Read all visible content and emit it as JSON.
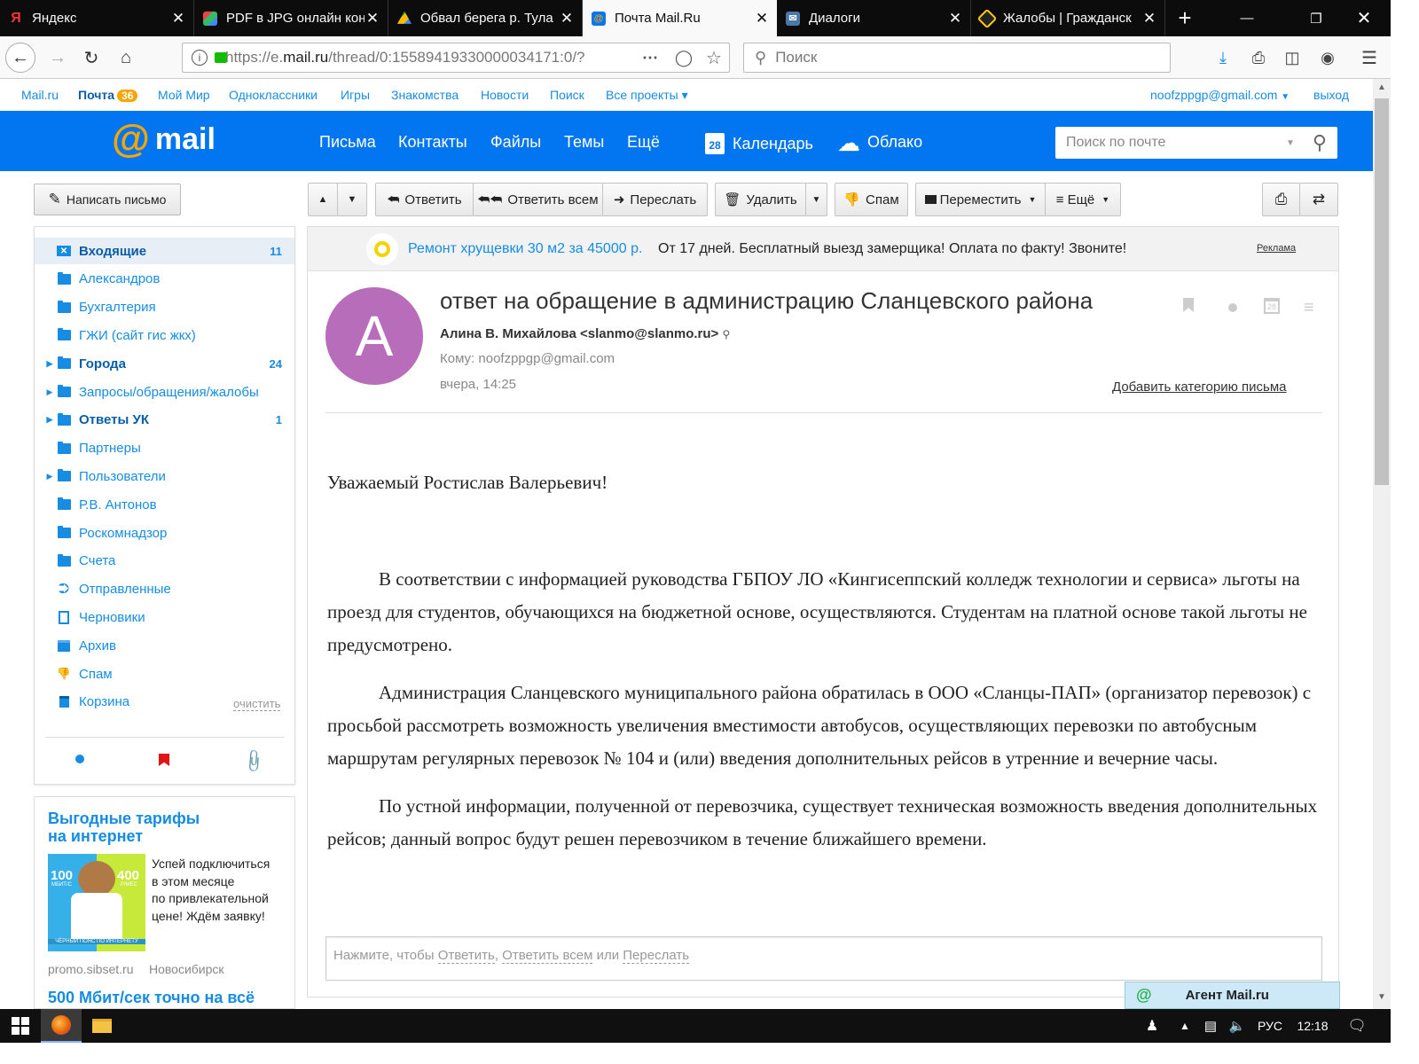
{
  "browser": {
    "tabs": [
      {
        "title": "Яндекс",
        "icon": "yandex-icon",
        "active": false
      },
      {
        "title": "PDF в JPG онлайн конвертер",
        "icon": "pdf-icon",
        "active": false
      },
      {
        "title": "Обвал берега р. Тула",
        "icon": "google-drive-icon",
        "active": false
      },
      {
        "title": "Почта Mail.Ru",
        "icon": "mailru-icon",
        "active": true
      },
      {
        "title": "Диалоги",
        "icon": "chat-icon",
        "active": false
      },
      {
        "title": "Жалобы | Гражданск",
        "icon": "complaints-icon",
        "active": false
      }
    ],
    "url_prefix": "https://e.",
    "url_host": "mail.ru",
    "url_path": "/thread/0:15589419330000034171:0/?",
    "search_placeholder": "Поиск"
  },
  "portal": {
    "links": [
      {
        "label": "Mail.ru"
      },
      {
        "label": "Почта",
        "badge": "36"
      },
      {
        "label": "Мой Мир"
      },
      {
        "label": "Одноклассники"
      },
      {
        "label": "Игры"
      },
      {
        "label": "Знакомства"
      },
      {
        "label": "Новости"
      },
      {
        "label": "Поиск"
      },
      {
        "label": "Все проекты"
      }
    ],
    "user_email": "noofzppgp@gmail.com",
    "logout": "выход"
  },
  "header": {
    "logo_text": "mail",
    "nav": [
      "Письма",
      "Контакты",
      "Файлы",
      "Темы",
      "Ещё"
    ],
    "calendar": "Календарь",
    "calendar_day": "28",
    "cloud": "Облако",
    "search_placeholder": "Поиск по почте"
  },
  "sidebar": {
    "compose": "Написать письмо",
    "folders": [
      {
        "label": "Входящие",
        "count": "11",
        "icon": "inbox-icon",
        "bold": true,
        "active": true,
        "expand": false
      },
      {
        "label": "Александров",
        "count": "",
        "icon": "folder-icon",
        "bold": false,
        "active": false,
        "expand": false
      },
      {
        "label": "Бухгалтерия",
        "count": "",
        "icon": "folder-icon",
        "bold": false,
        "active": false,
        "expand": false
      },
      {
        "label": "ГЖИ (сайт гис жкх)",
        "count": "",
        "icon": "folder-icon",
        "bold": false,
        "active": false,
        "expand": false
      },
      {
        "label": "Города",
        "count": "24",
        "icon": "folder-icon",
        "bold": true,
        "active": false,
        "expand": true
      },
      {
        "label": "Запросы/обращения/жалобы",
        "count": "",
        "icon": "folder-icon",
        "bold": false,
        "active": false,
        "expand": true
      },
      {
        "label": "Ответы УК",
        "count": "1",
        "icon": "folder-icon",
        "bold": true,
        "active": false,
        "expand": true
      },
      {
        "label": "Партнеры",
        "count": "",
        "icon": "folder-icon",
        "bold": false,
        "active": false,
        "expand": false
      },
      {
        "label": "Пользователи",
        "count": "",
        "icon": "folder-icon",
        "bold": false,
        "active": false,
        "expand": true
      },
      {
        "label": "Р.В. Антонов",
        "count": "",
        "icon": "folder-icon",
        "bold": false,
        "active": false,
        "expand": false
      },
      {
        "label": "Роскомнадзор",
        "count": "",
        "icon": "folder-icon",
        "bold": false,
        "active": false,
        "expand": false
      },
      {
        "label": "Счета",
        "count": "",
        "icon": "folder-icon",
        "bold": false,
        "active": false,
        "expand": false
      },
      {
        "label": "Отправленные",
        "count": "",
        "icon": "sent-icon",
        "bold": false,
        "active": false,
        "expand": false
      },
      {
        "label": "Черновики",
        "count": "",
        "icon": "drafts-icon",
        "bold": false,
        "active": false,
        "expand": false
      },
      {
        "label": "Архив",
        "count": "",
        "icon": "archive-icon",
        "bold": false,
        "active": false,
        "expand": false
      },
      {
        "label": "Спам",
        "count": "",
        "icon": "spam-icon",
        "bold": false,
        "active": false,
        "expand": false
      },
      {
        "label": "Корзина",
        "count": "",
        "icon": "trash-icon",
        "bold": false,
        "active": false,
        "expand": false
      }
    ],
    "clear": "очистить",
    "ad": {
      "title1": "Выгодные тарифы",
      "title2": "на интернет",
      "img_left": "100",
      "img_left_unit": "МБИТ/С",
      "img_right": "400",
      "img_right_unit": "Р/МЕС",
      "img_caption": "ЧЁРНЫЙ ПОЯС ПО ИНТЕРНЕТУ",
      "text": [
        "Успей подключиться",
        "в этом месяце",
        "по привлекательной",
        "цене! Ждём заявку!"
      ],
      "domain": "promo.sibset.ru",
      "city": "Новосибирск",
      "title3": "500 Мбит/сек точно на всё"
    }
  },
  "toolbar": {
    "reply": "Ответить",
    "reply_all": "Ответить всем",
    "forward": "Переслать",
    "delete": "Удалить",
    "spam": "Спам",
    "move": "Переместить",
    "more": "Ещё"
  },
  "message": {
    "ad_link": "Ремонт хрущевки 30 м2 за 45000 р.",
    "ad_text": "От 17 дней. Бесплатный выезд замерщика! Оплата по факту! Звоните!",
    "ad_label": "Реклама",
    "avatar_letter": "А",
    "subject": "ответ на обращение в администрацию Сланцевского района",
    "sender": "Алина В. Михайлова <slanmo@slanmo.ru>",
    "to": "Кому: noofzppgp@gmail.com",
    "date": "вчера, 14:25",
    "calendar_day": "28",
    "add_category": "Добавить категорию письма",
    "greeting": "Уважаемый Ростислав Валерьевич!",
    "paragraphs": [
      "В соответствии с информацией руководства ГБПОУ ЛО «Кингисеппский колледж технологии и сервиса» льготы на проезд для студентов, обучающихся на бюджетной основе, осуществляются. Студентам на платной основе такой льготы не предусмотрено.",
      "Администрация Сланцевского муниципального района обратилась в ООО «Сланцы-ПАП» (организатор перевозок) с просьбой рассмотреть возможность увеличения вместимости автобусов, осуществляющих перевозки по автобусным маршрутам регулярных перевозок № 104 и (или) введения дополнительных рейсов в утренние и вечерние часы.",
      "По устной информации, полученной от перевозчика, существует техническая возможность введения дополнительных рейсов; данный вопрос будут решен перевозчиком в течение ближайшего времени."
    ],
    "reply_hint": "Нажмите, чтобы",
    "reply_link1": "Ответить",
    "reply_link2": "Ответить всем",
    "reply_or": "или",
    "reply_link3": "Переслать"
  },
  "agent": {
    "label": "Агент Mail.ru"
  },
  "taskbar": {
    "lang": "РУС",
    "time": "12:18"
  },
  "colors": {
    "header_blue": "#0275f0",
    "link_blue": "#168de2",
    "orange": "#f7a600",
    "avatar": "#b86dba"
  }
}
